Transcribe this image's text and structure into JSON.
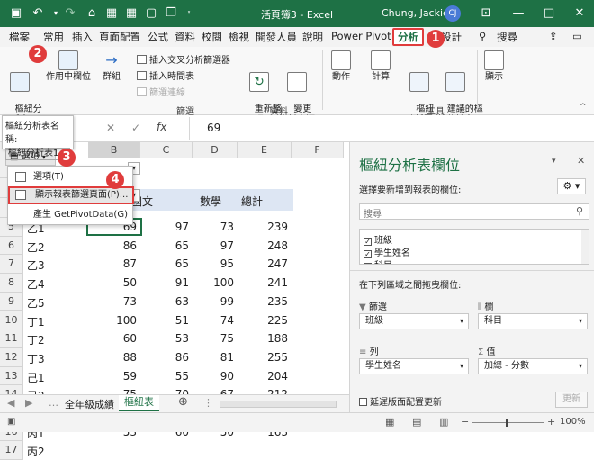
{
  "titlebar": {
    "title": "活頁簿3 - Excel",
    "user": "Chung, Jackie",
    "user_initials": "CJ"
  },
  "tabs": [
    "檔案",
    "常用",
    "插入",
    "頁面配置",
    "公式",
    "資料",
    "校閱",
    "檢視",
    "開發人員",
    "說明",
    "Power Pivot",
    "分析",
    "設計"
  ],
  "tell_me": "搜尋",
  "ribbon": {
    "pivot_table": "樞紐分\n析表",
    "active_field": "作用中欄位",
    "group": "群組",
    "insert_slicer": "插入交叉分析篩選器",
    "insert_timeline": "插入時間表",
    "filter_connections": "篩選連線",
    "filter_group": "篩選",
    "refresh": "重新整\n理",
    "change_source": "變更\n資料來源",
    "data_group": "資料",
    "actions": "動作",
    "calculations": "計算",
    "pivot_chart": "樞紐\n分析圖",
    "recommended": "建議的樞\n紐分析表",
    "tools_group": "工具",
    "show": "顯示"
  },
  "namebox": {
    "label": "樞紐分析表名稱:",
    "value": "樞紐分析表1"
  },
  "formula": {
    "value": "69",
    "fx": "fx"
  },
  "columns": [
    "B",
    "C",
    "D",
    "E",
    "F"
  ],
  "header_row": [
    "國文",
    "數學",
    "總計"
  ],
  "rows": [
    {
      "r": "5",
      "name": "乙1",
      "v": [
        "69",
        "97",
        "73",
        "239"
      ]
    },
    {
      "r": "6",
      "name": "乙2",
      "v": [
        "86",
        "65",
        "97",
        "248"
      ]
    },
    {
      "r": "7",
      "name": "乙3",
      "v": [
        "87",
        "65",
        "95",
        "247"
      ]
    },
    {
      "r": "8",
      "name": "乙4",
      "v": [
        "50",
        "91",
        "100",
        "241"
      ]
    },
    {
      "r": "9",
      "name": "乙5",
      "v": [
        "73",
        "63",
        "99",
        "235"
      ]
    },
    {
      "r": "10",
      "name": "丁1",
      "v": [
        "100",
        "51",
        "74",
        "225"
      ]
    },
    {
      "r": "11",
      "name": "丁2",
      "v": [
        "60",
        "53",
        "75",
        "188"
      ]
    },
    {
      "r": "12",
      "name": "丁3",
      "v": [
        "88",
        "86",
        "81",
        "255"
      ]
    },
    {
      "r": "13",
      "name": "己1",
      "v": [
        "59",
        "55",
        "90",
        "204"
      ]
    },
    {
      "r": "14",
      "name": "己2",
      "v": [
        "75",
        "70",
        "67",
        "212"
      ]
    },
    {
      "r": "15",
      "name": "己3",
      "v": [
        "58",
        "69",
        "53",
        "180"
      ]
    },
    {
      "r": "16",
      "name": "丙1",
      "v": [
        "53",
        "60",
        "50",
        "163"
      ]
    },
    {
      "r": "17",
      "name": "丙2",
      "v": [
        "",
        "",
        "",
        ""
      ]
    }
  ],
  "options_button": "選項",
  "menu": {
    "item1": "選項(T)",
    "item2": "顯示報表篩選頁面(P)...",
    "item3": "產生 GetPivotData(G)"
  },
  "sheets": [
    "全年級成績",
    "樞紐表"
  ],
  "pane": {
    "title": "樞紐分析表欄位",
    "subtitle": "選擇要新增到報表的欄位:",
    "search_placeholder": "搜尋",
    "fields": [
      "班級",
      "學生姓名",
      "科目"
    ],
    "drag_hint": "在下列區域之間拖曳欄位:",
    "filters_label": "篩選",
    "columns_label": "欄",
    "rows_label": "列",
    "values_label": "值",
    "filter_value": "班級",
    "column_value": "科目",
    "row_value": "學生姓名",
    "value_value": "加總 - 分數",
    "defer": "延遲版面配置更新",
    "update": "更新"
  },
  "status": {
    "zoom": "100%"
  },
  "callouts": [
    "1",
    "2",
    "3",
    "4"
  ],
  "colors": {
    "excel_green": "#1e7145",
    "callout_red": "#e03c3c"
  }
}
